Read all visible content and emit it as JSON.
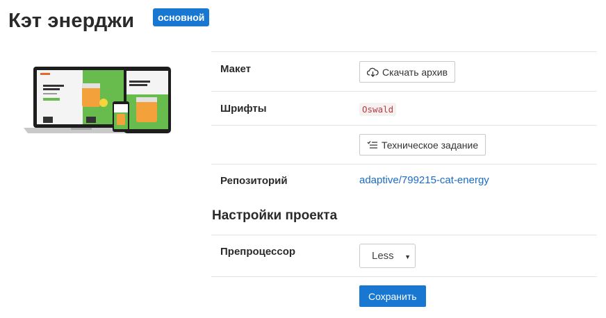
{
  "header": {
    "title": "Кэт энерджи",
    "badge": "основной"
  },
  "preview": {
    "alt": "mockup of website on laptop, tablet and phone",
    "brand_color": "#5ab84b"
  },
  "project": {
    "rows": [
      {
        "label": "Макет",
        "button": "Скачать архив",
        "icon": "cloud-download-icon"
      },
      {
        "label": "Шрифты",
        "font": "Oswald"
      },
      {
        "label": "",
        "button": "Техническое задание",
        "icon": "checklist-icon"
      },
      {
        "label": "Репозиторий",
        "link": "adaptive/799215-cat-energy"
      }
    ]
  },
  "settings": {
    "title": "Настройки проекта",
    "preprocessor_label": "Препроцессор",
    "preprocessor_value": "Less",
    "save_label": "Сохранить"
  },
  "colors": {
    "accent": "#1877d1",
    "link": "#1b6bc4",
    "code": "#b5393f"
  }
}
